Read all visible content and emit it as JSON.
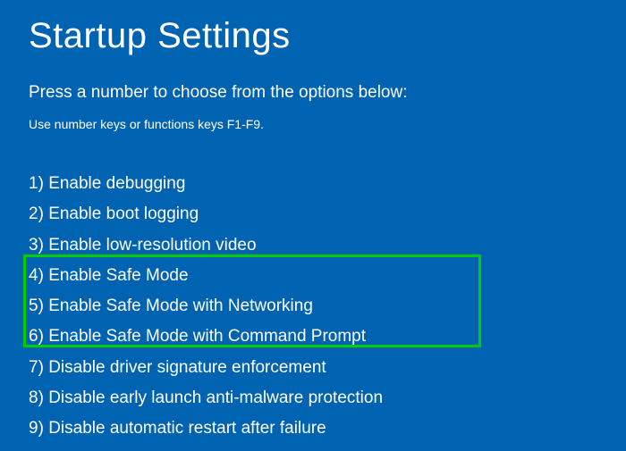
{
  "title": "Startup Settings",
  "subtitle": "Press a number to choose from the options below:",
  "hint": "Use number keys or functions keys F1-F9.",
  "options": [
    {
      "num": "1",
      "label": "Enable debugging"
    },
    {
      "num": "2",
      "label": "Enable boot logging"
    },
    {
      "num": "3",
      "label": "Enable low-resolution video"
    },
    {
      "num": "4",
      "label": "Enable Safe Mode"
    },
    {
      "num": "5",
      "label": "Enable Safe Mode with Networking"
    },
    {
      "num": "6",
      "label": "Enable Safe Mode with Command Prompt"
    },
    {
      "num": "7",
      "label": "Disable driver signature enforcement"
    },
    {
      "num": "8",
      "label": "Disable early launch anti-malware protection"
    },
    {
      "num": "9",
      "label": "Disable automatic restart after failure"
    }
  ],
  "highlight": {
    "start_index": 3,
    "end_index": 5
  }
}
